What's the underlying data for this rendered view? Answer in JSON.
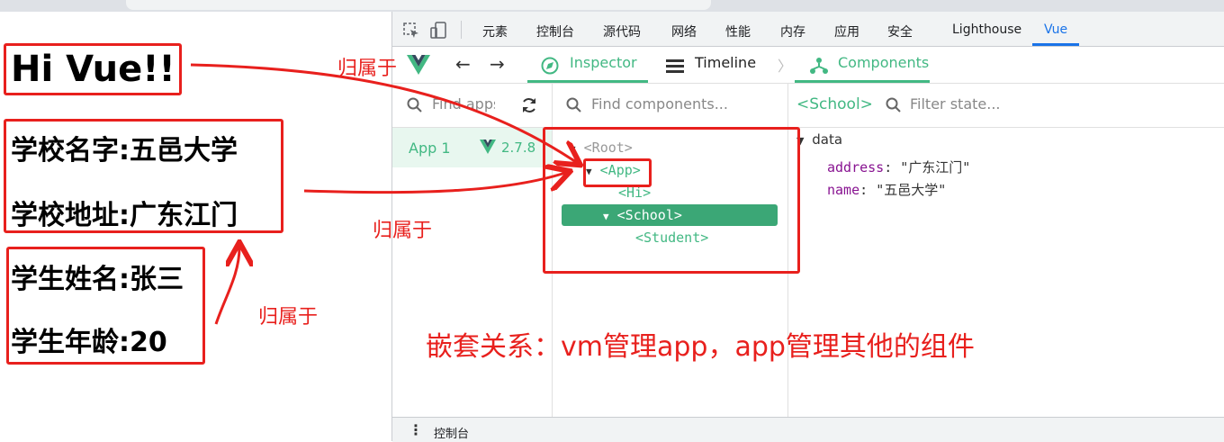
{
  "page": {
    "title": "Hi Vue!!",
    "school_name": "学校名字:五邑大学",
    "school_address": "学校地址:广东江门",
    "student_name": "学生姓名:张三",
    "student_age": "学生年龄:20"
  },
  "devtools": {
    "tabs": [
      "元素",
      "控制台",
      "源代码",
      "网络",
      "性能",
      "内存",
      "应用",
      "安全",
      "Lighthouse",
      "Vue"
    ],
    "active_tab": "Vue",
    "vue_toolbar": {
      "inspector": "Inspector",
      "timeline": "Timeline",
      "components": "Components"
    },
    "search": {
      "apps_placeholder": "Find apps...",
      "components_placeholder": "Find components...",
      "selected_component": "<School>",
      "state_placeholder": "Filter state..."
    },
    "apps": [
      {
        "name": "App 1",
        "version": "2.7.8"
      }
    ],
    "tree": {
      "root": "<Root>",
      "app": "<App>",
      "hi": "<Hi>",
      "school": "<School>",
      "student": "<Student>"
    },
    "state": {
      "section": "data",
      "address_key": "address",
      "address_value": "\"广东江门\"",
      "name_key": "name",
      "name_value": "\"五邑大学\""
    },
    "drawer": {
      "label": "控制台"
    }
  },
  "annotations": {
    "belongs_1": "归属于",
    "belongs_2": "归属于",
    "belongs_3": "归属于",
    "nesting_note": "嵌套关系：vm管理app，app管理其他的组件"
  },
  "colors": {
    "vue_green": "#42b883",
    "selected_row": "#3ba776",
    "annotation_red": "#e8201d",
    "tab_active": "#1a73e8"
  }
}
